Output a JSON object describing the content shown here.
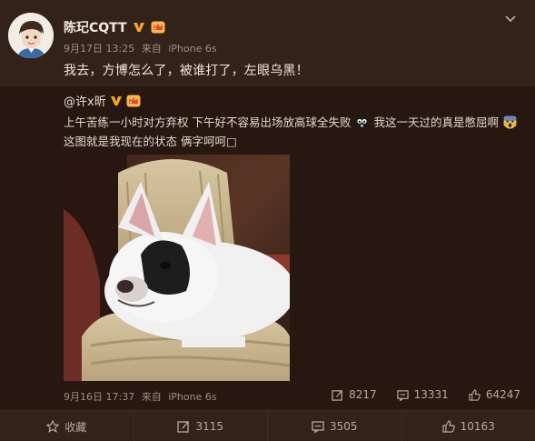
{
  "post": {
    "author": "陈玘CQTT",
    "date": "9月17日 13:25",
    "via_label": "来自",
    "device": "iPhone 6s",
    "text": "我去，方博怎么了，被谁打了，左眼乌黑！"
  },
  "repost": {
    "author": "@许x昕",
    "text_part1": "上午苦练一小时对方弃权 下午好不容易出场放高球全失败",
    "text_part2": "我这一天过的真是憋屈啊",
    "text_part3": "这图就是我现在的状态 俩字呵呵□",
    "date": "9月16日 17:37",
    "via_label": "来自",
    "device": "iPhone 6s",
    "stats": {
      "reposts": "8217",
      "comments": "13331",
      "likes": "64247"
    }
  },
  "footer": {
    "favorite_label": "收藏",
    "reposts": "3115",
    "comments": "3505",
    "likes": "10163"
  },
  "colors": {
    "background": "#33221a",
    "repost_background": "#261711",
    "verified_badge": "#f5a623",
    "text_muted": "#9c8f83"
  },
  "icons": [
    "chevron-down-icon",
    "verified-icon",
    "crown-icon",
    "repost-icon",
    "comment-icon",
    "like-icon",
    "star-icon",
    "emoji-shocked-icon",
    "emoji-scream-icon"
  ]
}
